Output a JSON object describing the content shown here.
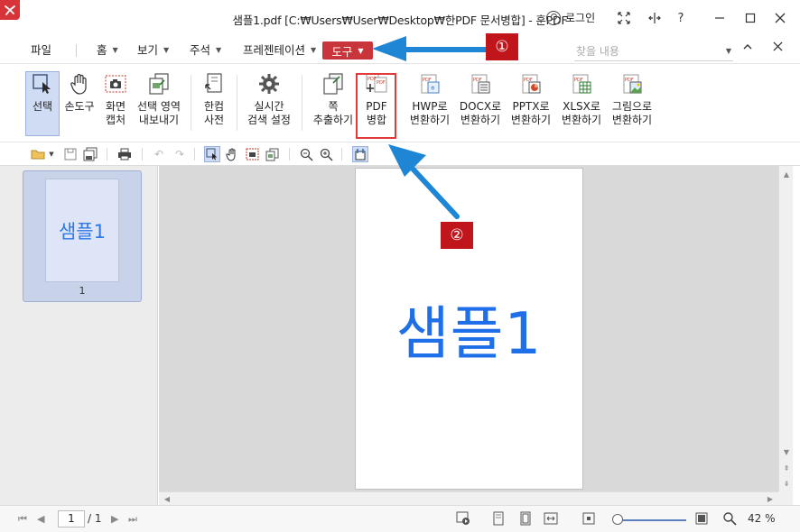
{
  "window": {
    "title": "샘플1.pdf [C:₩Users₩User₩Desktop₩한PDF 문서병합] - 훈PDF",
    "login": "로그인"
  },
  "menu": {
    "file": "파일",
    "home": "홈",
    "view": "보기",
    "annotate": "주석",
    "present": "프레젠테이션",
    "tools": "도구",
    "search_placeholder": "찾을 내용"
  },
  "ribbon": [
    {
      "line1": "선택",
      "line2": ""
    },
    {
      "line1": "손도구",
      "line2": ""
    },
    {
      "line1": "화면",
      "line2": "캡처"
    },
    {
      "line1": "선택 영역",
      "line2": "내보내기"
    },
    {
      "line1": "한컴",
      "line2": "사전"
    },
    {
      "line1": "실시간",
      "line2": "검색 설정"
    },
    {
      "line1": "쪽",
      "line2": "추출하기"
    },
    {
      "line1": "PDF",
      "line2": "병합"
    },
    {
      "line1": "HWP로",
      "line2": "변환하기"
    },
    {
      "line1": "DOCX로",
      "line2": "변환하기"
    },
    {
      "line1": "PPTX로",
      "line2": "변환하기"
    },
    {
      "line1": "XLSX로",
      "line2": "변환하기"
    },
    {
      "line1": "그림으로",
      "line2": "변환하기"
    }
  ],
  "thumbnail": {
    "label": "샘플1",
    "page_number": "1"
  },
  "document": {
    "text": "샘플1"
  },
  "status": {
    "current_page": "1",
    "total_pages": "/ 1",
    "zoom": "42 %"
  },
  "annotations": {
    "badge1": "①",
    "badge2": "②"
  },
  "colors": {
    "accent_red": "#c8363b",
    "highlight_red": "#e03a3a",
    "badge_red": "#c0151b",
    "arrow_blue": "#1e86d4",
    "doc_text_blue": "#1f6fe8"
  }
}
